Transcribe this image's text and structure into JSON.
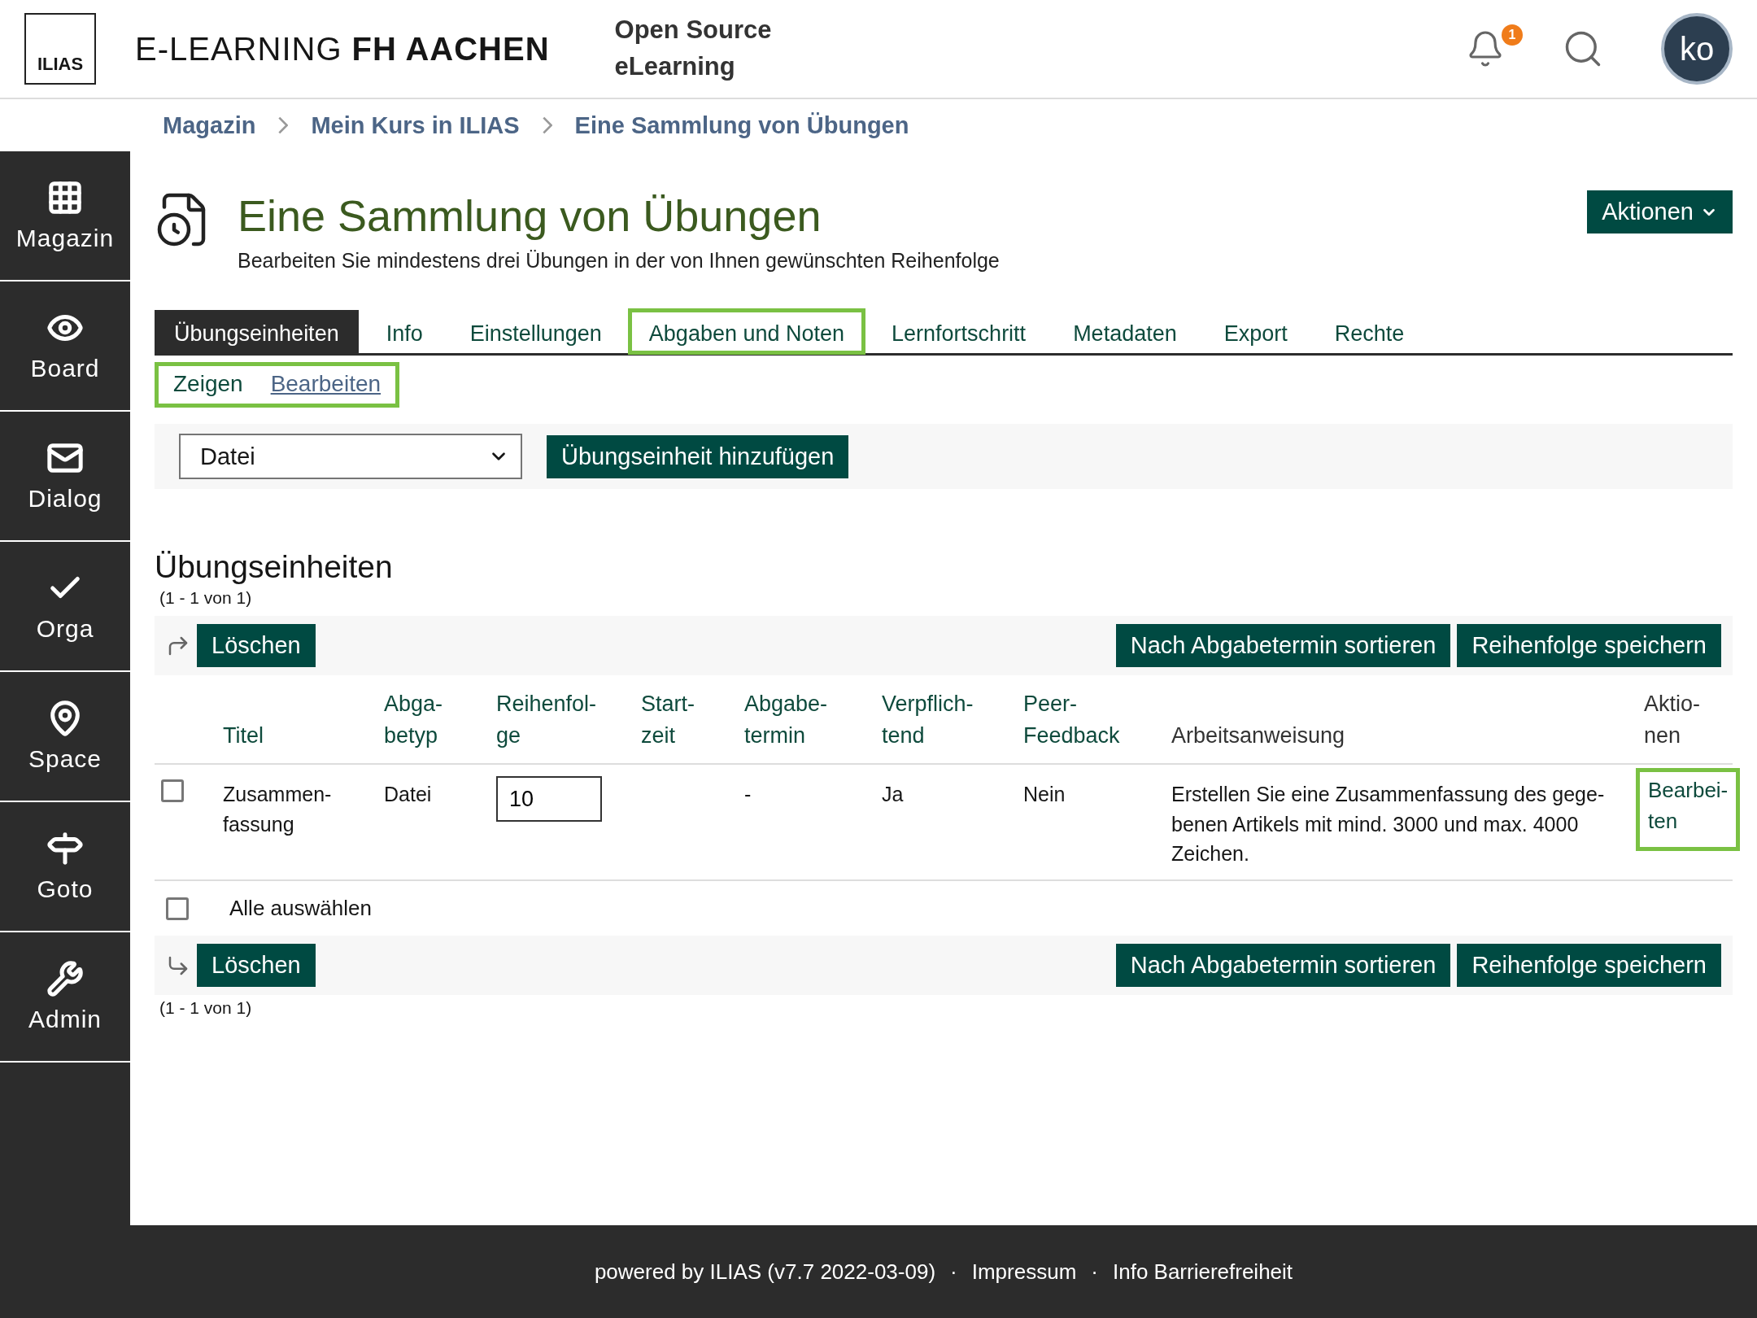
{
  "header": {
    "logo": "ILIAS",
    "site_title_light": "E-LEARNING",
    "site_title_bold": "FH AACHEN",
    "tagline_line1": "Open Source",
    "tagline_line2": "eLearning",
    "notification_count": "1",
    "avatar": "ko"
  },
  "breadcrumbs": [
    "Magazin",
    "Mein Kurs in ILIAS",
    "Eine Sammlung von Übungen"
  ],
  "sidebar": {
    "items": [
      {
        "kind": "grid",
        "label": "Magazin"
      },
      {
        "kind": "eye",
        "label": "Board"
      },
      {
        "kind": "mail",
        "label": "Dialog"
      },
      {
        "kind": "check",
        "label": "Orga"
      },
      {
        "kind": "pin",
        "label": "Space"
      },
      {
        "kind": "signpost",
        "label": "Goto"
      },
      {
        "kind": "tools",
        "label": "Admin"
      }
    ]
  },
  "page": {
    "title": "Eine Sammlung von Übungen",
    "description": "Bearbeiten Sie mindestens drei Übungen in der von Ihnen gewünschten Reihenfolge",
    "actions_button": "Aktionen"
  },
  "tabs": [
    {
      "label": "Übungseinheiten",
      "selected": true,
      "highlighted": false
    },
    {
      "label": "Info",
      "selected": false,
      "highlighted": false
    },
    {
      "label": "Einstellungen",
      "selected": false,
      "highlighted": false
    },
    {
      "label": "Abgaben und Noten",
      "selected": false,
      "highlighted": true
    },
    {
      "label": "Lernfortschritt",
      "selected": false,
      "highlighted": false
    },
    {
      "label": "Metadaten",
      "selected": false,
      "highlighted": false
    },
    {
      "label": "Export",
      "selected": false,
      "highlighted": false
    },
    {
      "label": "Rechte",
      "selected": false,
      "highlighted": false
    }
  ],
  "subtabs": {
    "highlighted": true,
    "items": [
      {
        "label": "Zeigen",
        "selected": true
      },
      {
        "label": "Bearbeiten",
        "selected": false
      }
    ]
  },
  "toolbar": {
    "type_select": "Datei",
    "add_button": "Übungseinheit hinzufügen"
  },
  "table": {
    "title": "Übungseinheiten",
    "range_top": "(1 - 1 von 1)",
    "range_bottom": "(1 - 1 von 1)",
    "top_bar": {
      "delete_button": "Löschen",
      "sort_button": "Nach Abgabetermin sortieren",
      "save_order_button": "Reihenfolge speichern"
    },
    "bottom_bar": {
      "delete_button": "Löschen",
      "sort_button": "Nach Abgabetermin sortieren",
      "save_order_button": "Reihenfolge speichern"
    },
    "columns": [
      {
        "label": "Titel",
        "sortable": true
      },
      {
        "label": "Abga-\nbetyp",
        "sortable": true
      },
      {
        "label": "Reihenfol-\nge",
        "sortable": true
      },
      {
        "label": "Start-\nzeit",
        "sortable": true
      },
      {
        "label": "Abgabe-\ntermin",
        "sortable": true
      },
      {
        "label": "Verpflich-\ntend",
        "sortable": true
      },
      {
        "label": "Peer-\nFeedback",
        "sortable": true
      },
      {
        "label": "Arbeitsanweisung",
        "sortable": false
      },
      {
        "label": "Aktio-\nnen",
        "sortable": false
      }
    ],
    "rows": [
      {
        "checked": false,
        "title": "Zusammen-\nfassung",
        "type": "Datei",
        "order": "10",
        "start": "",
        "deadline": "-",
        "mandatory": "Ja",
        "peer_feedback": "Nein",
        "instruction": "Erstellen Sie eine Zusammenfassung des gege-\nbenen Artikels mit mind. 3000 und max. 4000\nZeichen.",
        "action": "Bearbei-\nten",
        "action_highlighted": true
      }
    ],
    "select_all": {
      "label": "Alle auswählen",
      "checked": false
    }
  },
  "footer": {
    "powered_by": "powered by ILIAS (v7.7 2022-03-09)",
    "separator_1": "·",
    "imprint": "Impressum",
    "separator_2": "·",
    "accessibility": "Info Barrierefreiheit"
  }
}
